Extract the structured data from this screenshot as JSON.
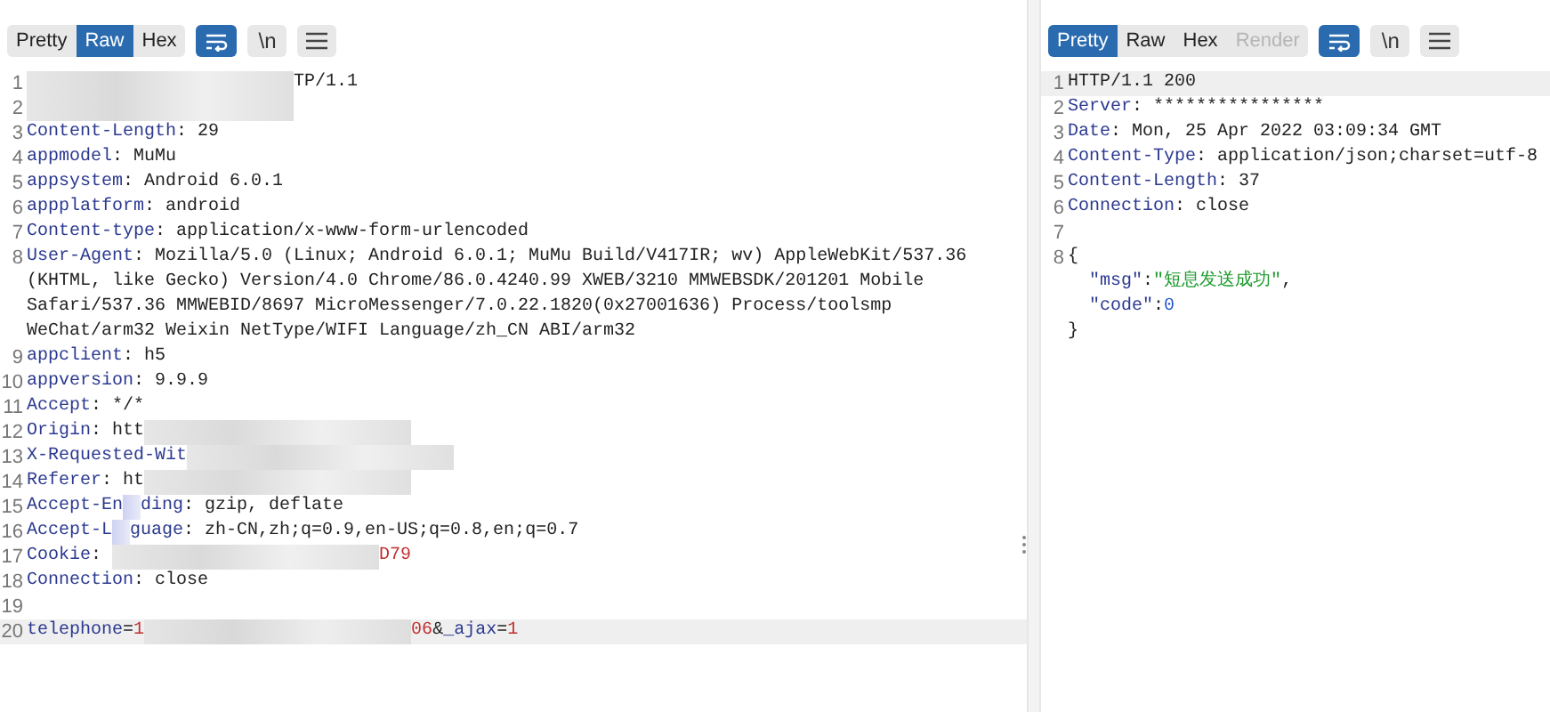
{
  "panes": [
    {
      "views": [
        {
          "label": "Pretty",
          "selected": false,
          "disabled": false
        },
        {
          "label": "Raw",
          "selected": true,
          "disabled": false
        },
        {
          "label": "Hex",
          "selected": false,
          "disabled": false
        }
      ],
      "wrap_on": true,
      "newline_label": "\\n",
      "lines": [
        {
          "num": "1",
          "highlighted": false,
          "parts": [
            {
              "kind": "redacted"
            },
            {
              "kind": "value",
              "text": "TP/1.1"
            }
          ]
        },
        {
          "num": "2",
          "highlighted": false,
          "parts": [
            {
              "kind": "redacted"
            }
          ]
        },
        {
          "num": "3",
          "highlighted": false,
          "parts": [
            {
              "kind": "key",
              "text": "Content-Length"
            },
            {
              "kind": "value",
              "text": ": 29"
            }
          ]
        },
        {
          "num": "4",
          "highlighted": false,
          "parts": [
            {
              "kind": "key",
              "text": "appmodel"
            },
            {
              "kind": "value",
              "text": ": MuMu"
            }
          ]
        },
        {
          "num": "5",
          "highlighted": false,
          "parts": [
            {
              "kind": "key",
              "text": "appsystem"
            },
            {
              "kind": "value",
              "text": ": Android 6.0.1"
            }
          ]
        },
        {
          "num": "6",
          "highlighted": false,
          "parts": [
            {
              "kind": "key",
              "text": "appplatform"
            },
            {
              "kind": "value",
              "text": ": android"
            }
          ]
        },
        {
          "num": "7",
          "highlighted": false,
          "parts": [
            {
              "kind": "key",
              "text": "Content-type"
            },
            {
              "kind": "value",
              "text": ": application/x-www-form-urlencoded"
            }
          ]
        },
        {
          "num": "8",
          "highlighted": false,
          "parts": [
            {
              "kind": "key",
              "text": "User-Agent"
            },
            {
              "kind": "value",
              "text": ": Mozilla/5.0 (Linux; Android 6.0.1; MuMu Build/V417IR; wv) AppleWebKit/537.36"
            }
          ]
        },
        {
          "highlighted": false,
          "parts": [
            {
              "kind": "value",
              "text": "(KHTML, like Gecko) Version/4.0 Chrome/86.0.4240.99 XWEB/3210 MMWEBSDK/201201 Mobile"
            }
          ]
        },
        {
          "highlighted": false,
          "parts": [
            {
              "kind": "value",
              "text": "Safari/537.36 MMWEBID/8697 MicroMessenger/7.0.22.1820(0x27001636) Process/toolsmp"
            }
          ]
        },
        {
          "highlighted": false,
          "parts": [
            {
              "kind": "value",
              "text": "WeChat/arm32 Weixin NetType/WIFI Language/zh_CN ABI/arm32"
            }
          ]
        },
        {
          "num": "9",
          "highlighted": false,
          "parts": [
            {
              "kind": "key",
              "text": "appclient"
            },
            {
              "kind": "value",
              "text": ": h5"
            }
          ]
        },
        {
          "num": "10",
          "highlighted": false,
          "parts": [
            {
              "kind": "key",
              "text": "appversion"
            },
            {
              "kind": "value",
              "text": ": 9.9.9"
            }
          ]
        },
        {
          "num": "11",
          "highlighted": false,
          "parts": [
            {
              "kind": "key",
              "text": "Accept"
            },
            {
              "kind": "value",
              "text": ": */*"
            }
          ]
        },
        {
          "num": "12",
          "highlighted": false,
          "parts": [
            {
              "kind": "key",
              "text": "Origin"
            },
            {
              "kind": "value",
              "text": ": htt"
            },
            {
              "kind": "redacted"
            }
          ]
        },
        {
          "num": "13",
          "highlighted": false,
          "parts": [
            {
              "kind": "key",
              "text": "X-Requested-Wit"
            },
            {
              "kind": "redacted"
            }
          ]
        },
        {
          "num": "14",
          "highlighted": false,
          "parts": [
            {
              "kind": "key",
              "text": "Referer"
            },
            {
              "kind": "value",
              "text": ": ht"
            },
            {
              "kind": "redacted"
            }
          ]
        },
        {
          "num": "15",
          "highlighted": false,
          "parts": [
            {
              "kind": "key",
              "text": "Accept-En"
            },
            {
              "kind": "scribble"
            },
            {
              "kind": "key",
              "text": "ding"
            },
            {
              "kind": "value",
              "text": ": gzip, deflate"
            }
          ]
        },
        {
          "num": "16",
          "highlighted": false,
          "parts": [
            {
              "kind": "key",
              "text": "Accept-L"
            },
            {
              "kind": "scribble"
            },
            {
              "kind": "key",
              "text": "guage"
            },
            {
              "kind": "value",
              "text": ": zh-CN,zh;q=0.9,en-US;q=0.8,en;q=0.7"
            }
          ]
        },
        {
          "num": "17",
          "highlighted": false,
          "parts": [
            {
              "kind": "key",
              "text": "Cookie"
            },
            {
              "kind": "value",
              "text": ": "
            },
            {
              "kind": "redacted"
            },
            {
              "kind": "red",
              "text": "D79"
            }
          ]
        },
        {
          "num": "18",
          "highlighted": false,
          "parts": [
            {
              "kind": "key",
              "text": "Connection"
            },
            {
              "kind": "value",
              "text": ": close"
            }
          ]
        },
        {
          "num": "19",
          "highlighted": false
        },
        {
          "num": "20",
          "highlighted": true,
          "parts": [
            {
              "kind": "key",
              "text": "telephone"
            },
            {
              "kind": "value",
              "text": "="
            },
            {
              "kind": "red",
              "text": "1"
            },
            {
              "kind": "redacted"
            },
            {
              "kind": "red",
              "text": "06"
            },
            {
              "kind": "value",
              "text": "&"
            },
            {
              "kind": "key",
              "text": "_ajax"
            },
            {
              "kind": "value",
              "text": "="
            },
            {
              "kind": "red",
              "text": "1"
            }
          ]
        }
      ]
    },
    {
      "views": [
        {
          "label": "Pretty",
          "selected": true,
          "disabled": false
        },
        {
          "label": "Raw",
          "selected": false,
          "disabled": false
        },
        {
          "label": "Hex",
          "selected": false,
          "disabled": false
        },
        {
          "label": "Render",
          "selected": false,
          "disabled": true
        }
      ],
      "wrap_on": true,
      "newline_label": "\\n",
      "lines": [
        {
          "num": "1",
          "highlighted": true,
          "parts": [
            {
              "kind": "value",
              "text": "HTTP/1.1 200"
            }
          ]
        },
        {
          "num": "2",
          "highlighted": false,
          "parts": [
            {
              "kind": "key",
              "text": "Server"
            },
            {
              "kind": "value",
              "text": ": ****************"
            }
          ]
        },
        {
          "num": "3",
          "highlighted": false,
          "parts": [
            {
              "kind": "key",
              "text": "Date"
            },
            {
              "kind": "value",
              "text": ": Mon, 25 Apr 2022 03:09:34 GMT"
            }
          ]
        },
        {
          "num": "4",
          "highlighted": false,
          "parts": [
            {
              "kind": "key",
              "text": "Content-Type"
            },
            {
              "kind": "value",
              "text": ": application/json;charset=utf-8"
            }
          ]
        },
        {
          "num": "5",
          "highlighted": false,
          "parts": [
            {
              "kind": "key",
              "text": "Content-Length"
            },
            {
              "kind": "value",
              "text": ": 37"
            }
          ]
        },
        {
          "num": "6",
          "highlighted": false,
          "parts": [
            {
              "kind": "key",
              "text": "Connection"
            },
            {
              "kind": "value",
              "text": ": close"
            }
          ]
        },
        {
          "num": "7",
          "highlighted": false
        },
        {
          "num": "8",
          "highlighted": false,
          "parts": [
            {
              "kind": "value",
              "text": "{"
            }
          ]
        },
        {
          "highlighted": false,
          "parts": [
            {
              "kind": "indent"
            },
            {
              "kind": "key",
              "text": "\"msg\""
            },
            {
              "kind": "value",
              "text": ":"
            },
            {
              "kind": "string",
              "text": "\"短息发送成功\""
            },
            {
              "kind": "value",
              "text": ","
            }
          ]
        },
        {
          "highlighted": false,
          "parts": [
            {
              "kind": "indent"
            },
            {
              "kind": "key",
              "text": "\"code\""
            },
            {
              "kind": "value",
              "text": ":"
            },
            {
              "kind": "number",
              "text": "0"
            }
          ]
        },
        {
          "highlighted": false,
          "parts": [
            {
              "kind": "value",
              "text": "}"
            }
          ]
        }
      ]
    }
  ]
}
